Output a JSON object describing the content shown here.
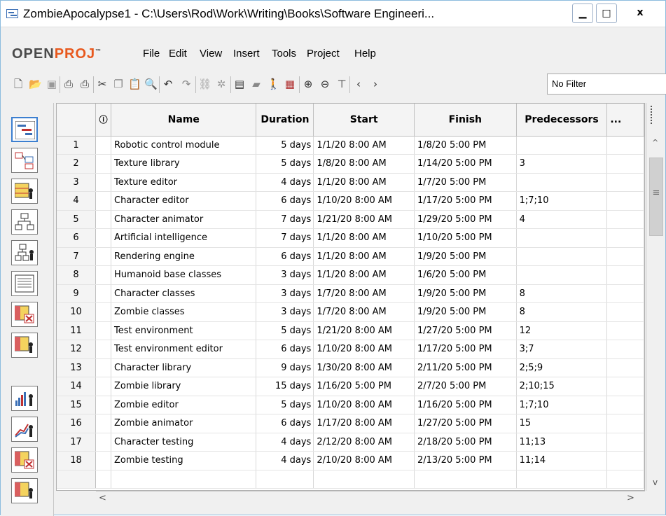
{
  "window": {
    "title": "ZombieApocalypse1 - C:\\Users\\Rod\\Work\\Writing\\Books\\Software Engineeri...",
    "minimize": "▁",
    "maximize": "□",
    "close": "x"
  },
  "logo": {
    "open": "OPEN",
    "proj": "PROJ",
    "tm": "™"
  },
  "menu": [
    "File",
    "Edit",
    "View",
    "Insert",
    "Tools",
    "Project",
    "Help"
  ],
  "toolbar": {
    "filter_value": "No Filter"
  },
  "table": {
    "columns": [
      "",
      "ⓘ",
      "Name",
      "Duration",
      "Start",
      "Finish",
      "Predecessors",
      "..."
    ],
    "rows": [
      [
        "1",
        "",
        "Robotic control module",
        "5 days",
        "1/1/20 8:00 AM",
        "1/8/20 5:00 PM",
        ""
      ],
      [
        "2",
        "",
        "Texture library",
        "5 days",
        "1/8/20 8:00 AM",
        "1/14/20 5:00 PM",
        "3"
      ],
      [
        "3",
        "",
        "Texture editor",
        "4 days",
        "1/1/20 8:00 AM",
        "1/7/20 5:00 PM",
        ""
      ],
      [
        "4",
        "",
        "Character editor",
        "6 days",
        "1/10/20 8:00 AM",
        "1/17/20 5:00 PM",
        "1;7;10"
      ],
      [
        "5",
        "",
        "Character animator",
        "7 days",
        "1/21/20 8:00 AM",
        "1/29/20 5:00 PM",
        "4"
      ],
      [
        "6",
        "",
        "Artificial intelligence",
        "7 days",
        "1/1/20 8:00 AM",
        "1/10/20 5:00 PM",
        ""
      ],
      [
        "7",
        "",
        "Rendering engine",
        "6 days",
        "1/1/20 8:00 AM",
        "1/9/20 5:00 PM",
        ""
      ],
      [
        "8",
        "",
        "Humanoid base classes",
        "3 days",
        "1/1/20 8:00 AM",
        "1/6/20 5:00 PM",
        ""
      ],
      [
        "9",
        "",
        "Character classes",
        "3 days",
        "1/7/20 8:00 AM",
        "1/9/20 5:00 PM",
        "8"
      ],
      [
        "10",
        "",
        "Zombie classes",
        "3 days",
        "1/7/20 8:00 AM",
        "1/9/20 5:00 PM",
        "8"
      ],
      [
        "11",
        "",
        "Test environment",
        "5 days",
        "1/21/20 8:00 AM",
        "1/27/20 5:00 PM",
        "12"
      ],
      [
        "12",
        "",
        "Test environment editor",
        "6 days",
        "1/10/20 8:00 AM",
        "1/17/20 5:00 PM",
        "3;7"
      ],
      [
        "13",
        "",
        "Character library",
        "9 days",
        "1/30/20 8:00 AM",
        "2/11/20 5:00 PM",
        "2;5;9"
      ],
      [
        "14",
        "",
        "Zombie library",
        "15 days",
        "1/16/20 5:00 PM",
        "2/7/20 5:00 PM",
        "2;10;15"
      ],
      [
        "15",
        "",
        "Zombie editor",
        "5 days",
        "1/10/20 8:00 AM",
        "1/16/20 5:00 PM",
        "1;7;10"
      ],
      [
        "16",
        "",
        "Zombie animator",
        "6 days",
        "1/17/20 8:00 AM",
        "1/27/20 5:00 PM",
        "15"
      ],
      [
        "17",
        "",
        "Character testing",
        "4 days",
        "2/12/20 8:00 AM",
        "2/18/20 5:00 PM",
        "11;13"
      ],
      [
        "18",
        "",
        "Zombie testing",
        "4 days",
        "2/10/20 8:00 AM",
        "2/13/20 5:00 PM",
        "11;14"
      ]
    ]
  },
  "scroll": {
    "up": "^",
    "down": "v",
    "left": "<",
    "right": ">",
    "grip": "≡"
  }
}
